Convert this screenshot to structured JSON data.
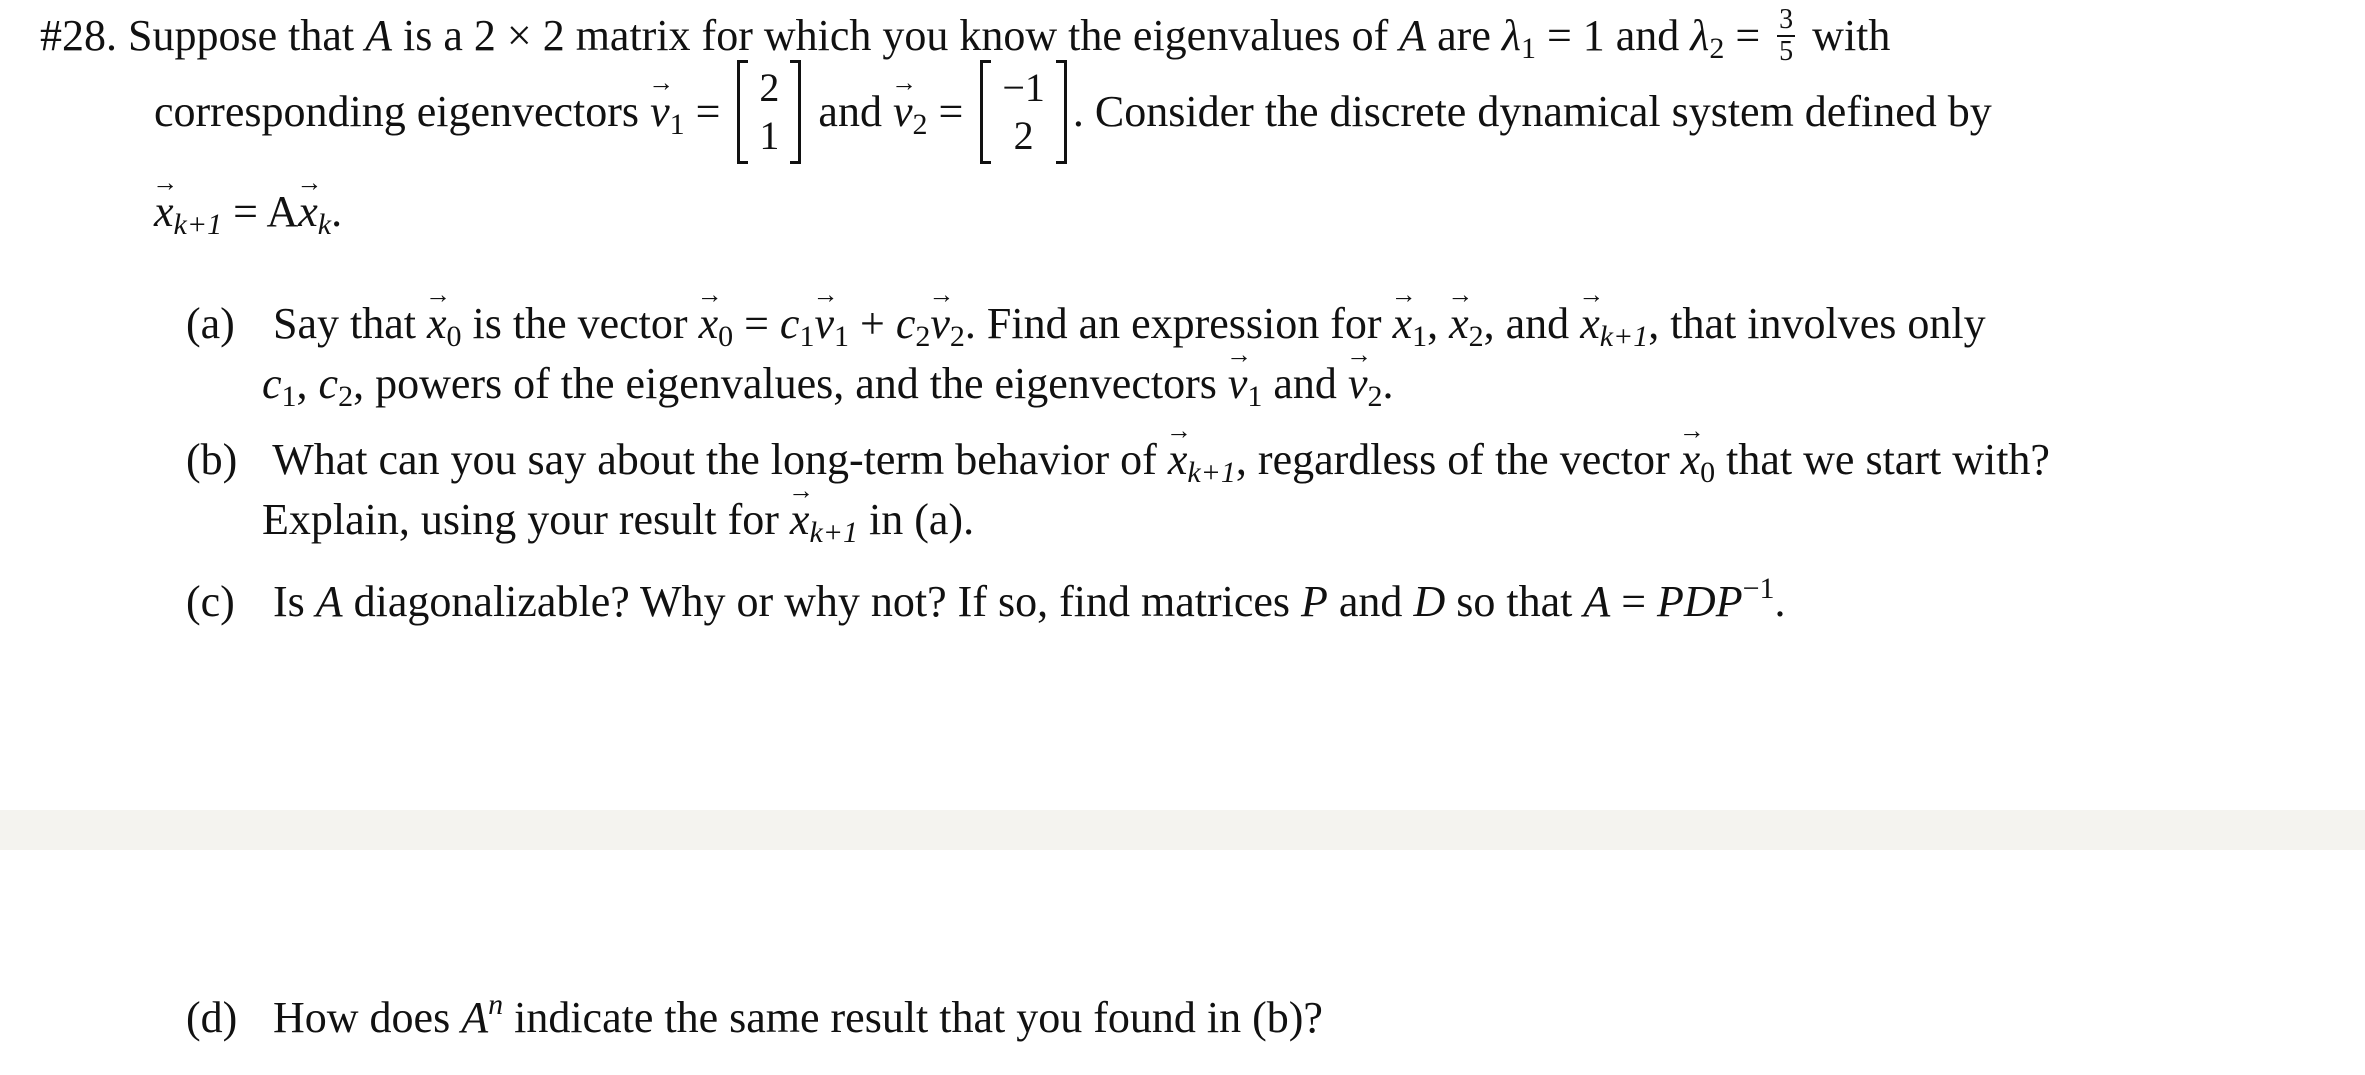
{
  "problem": {
    "number": "#28.",
    "intro_1": "Suppose that",
    "A": "A",
    "intro_2": "is a 2 × 2 matrix for which you know the eigenvalues of",
    "intro_3": "are",
    "lambda": "λ",
    "lambda1_sub": "1",
    "lambda1_value": "= 1 and",
    "lambda2_sub": "2",
    "equals": "=",
    "lambda2_num": "3",
    "lambda2_den": "5",
    "with": "with",
    "corr_text": "corresponding eigenvectors",
    "v": "v",
    "v1_sub": "1",
    "v1_entries": [
      "2",
      "1"
    ],
    "and": "and",
    "v2_sub": "2",
    "v2_entries": [
      "−1",
      "2"
    ],
    "consider": ". Consider the discrete dynamical system defined by",
    "x": "x",
    "sys_sub1": "k+1",
    "sys_mid": " = A",
    "sys_sub2": "k",
    "sys_end": "."
  },
  "parts": {
    "a": {
      "label": "(a)",
      "t1": "Say that",
      "x0_sub": "0",
      "t2": "is the vector",
      "eq": "=",
      "c": "c",
      "c1_sub": "1",
      "plus": "+",
      "c2_sub": "2",
      "t3": ". Find an expression for",
      "x1_sub": "1",
      "comma": ",",
      "x2_sub": "2",
      "and": ", and",
      "xk_sub": "k+1",
      "t4": ", that involves only",
      "l2_t1": ", powers of the eigenvalues, and the eigenvectors",
      "l2_and": "and",
      "l2_end": "."
    },
    "b": {
      "label": "(b)",
      "t1": "What can you say about the long-term behavior of",
      "xk_sub": "k+1",
      "t2": ", regardless of the vector",
      "x0_sub": "0",
      "t3": "that we start with?",
      "l2_t1": "Explain, using your result for",
      "l2_t2": "in (a)."
    },
    "c": {
      "label": "(c)",
      "t1": "Is",
      "A": "A",
      "t2": "diagonalizable? Why or why not? If so, find matrices",
      "P": "P",
      "and": "and",
      "D": "D",
      "t3": "so that",
      "eq": "=",
      "PDP": "PDP",
      "inv": "−1",
      "end": "."
    },
    "d": {
      "label": "(d)",
      "t1": "How does",
      "A": "A",
      "n": "n",
      "t2": "indicate the same result that you found in (b)?"
    }
  },
  "colors": {
    "page_background": "#ffffff",
    "page_gap": "#f4f3ef",
    "text": "#111111"
  }
}
